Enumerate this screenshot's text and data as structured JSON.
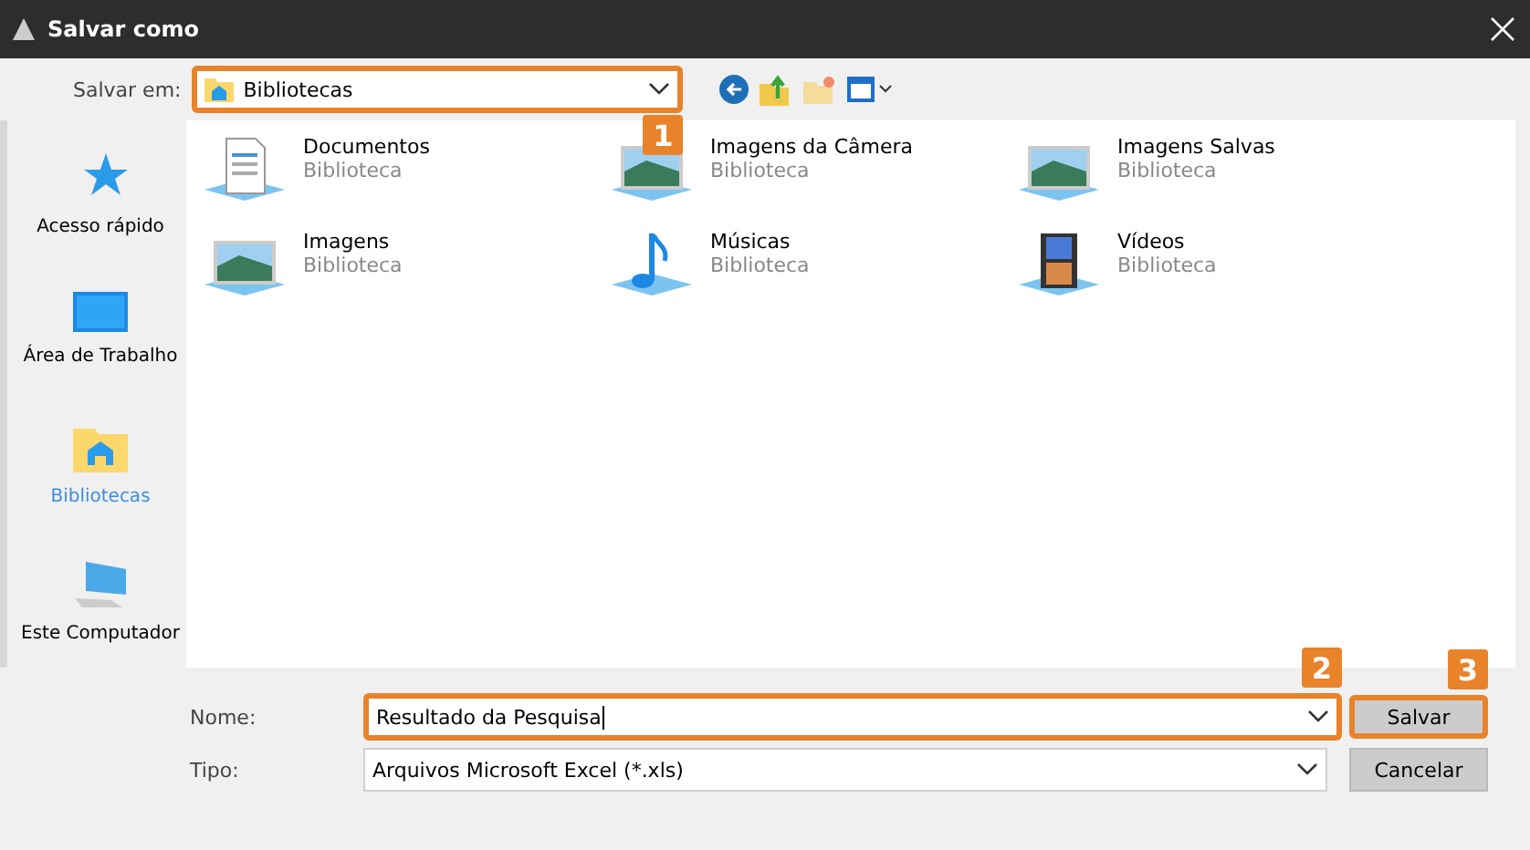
{
  "window": {
    "title": "Salvar como"
  },
  "location": {
    "label": "Salvar em:",
    "value": "Bibliotecas",
    "highlighted": true,
    "callout": "1"
  },
  "sidebar": {
    "items": [
      {
        "label": "Acesso rápido",
        "kind": "star",
        "selected": false
      },
      {
        "label": "Área de Trabalho",
        "kind": "desktop",
        "selected": false
      },
      {
        "label": "Bibliotecas",
        "kind": "library",
        "selected": true
      },
      {
        "label": "Este Computador",
        "kind": "computer",
        "selected": false
      }
    ]
  },
  "files": [
    {
      "name": "Documentos",
      "type": "Biblioteca",
      "kind": "document"
    },
    {
      "name": "Imagens da Câmera",
      "type": "Biblioteca",
      "kind": "picture"
    },
    {
      "name": "Imagens Salvas",
      "type": "Biblioteca",
      "kind": "picture"
    },
    {
      "name": "Imagens",
      "type": "Biblioteca",
      "kind": "picture"
    },
    {
      "name": "Músicas",
      "type": "Biblioteca",
      "kind": "music"
    },
    {
      "name": "Vídeos",
      "type": "Biblioteca",
      "kind": "video"
    }
  ],
  "name_field": {
    "label": "Nome:",
    "value": "Resultado da Pesquisa",
    "highlighted": true,
    "callout": "2"
  },
  "type_field": {
    "label": "Tipo:",
    "value": "Arquivos Microsoft Excel (*.xls)",
    "highlighted": false
  },
  "buttons": [
    {
      "label": "Salvar",
      "highlighted": true,
      "callout": "3"
    },
    {
      "label": "Cancelar",
      "highlighted": false
    }
  ]
}
